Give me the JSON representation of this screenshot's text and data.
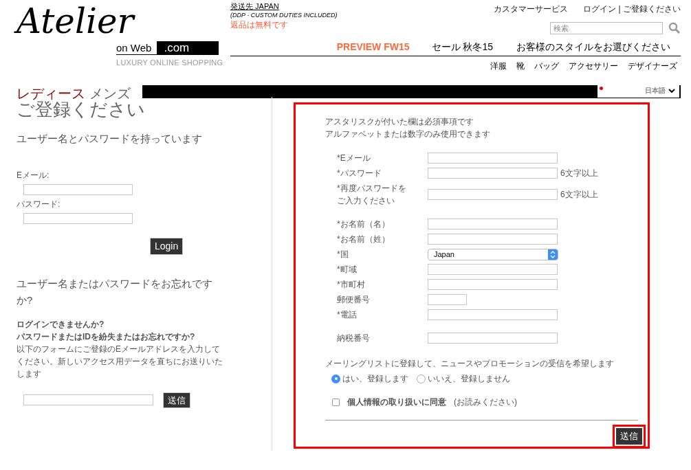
{
  "logo": {
    "script": "Atelier",
    "sub": "on Web",
    "domain": ".com",
    "tagline": "LUXURY ONLINE SHOPPING"
  },
  "shipping": {
    "destination": "発送先 JAPAN",
    "duties": "(DDP - CUSTOM DUTIES INCLUDED)",
    "returns": "返品は無料です"
  },
  "top_links": [
    "カスタマーサービス",
    "ログイン | ご登録ください"
  ],
  "search": {
    "placeholder": "検索"
  },
  "main_nav": [
    {
      "label": "PREVIEW FW15",
      "highlight": true
    },
    {
      "label": "セール 秋冬15",
      "highlight": false
    },
    {
      "label": "お客様のスタイルをお選びください",
      "highlight": false
    }
  ],
  "sub_nav": [
    "洋服",
    "靴",
    "バッグ",
    "アクセサリー",
    "デザイナーズ"
  ],
  "gender_tabs": [
    {
      "label": "レディース",
      "selected": true
    },
    {
      "label": "メンズ",
      "selected": false
    }
  ],
  "language": {
    "label": "日本語"
  },
  "page_title": "ご登録ください",
  "login": {
    "heading": "ユーザー名とパスワードを持っています",
    "fields": [
      {
        "label": "Eメール:"
      },
      {
        "label": "パスワード:"
      }
    ],
    "button": "Login"
  },
  "forgot": {
    "heading": "ユーザー名またはパスワードをお忘れですか?",
    "bold_lines": [
      "ログインできませんか?",
      "パスワードまたはIDを紛失またはお忘れですか?"
    ],
    "text": "以下のフォームにご登録のEメールアドレスを入力してください。新しいアクセス用データを直ちにお送りいたします",
    "button": "送信"
  },
  "register": {
    "notes": [
      "アスタリスクが付いた欄は必須事項です",
      "アルファベットまたは数字のみ使用できます"
    ],
    "fields": [
      {
        "label": "*Eメール",
        "kind": "text"
      },
      {
        "label": "*パスワード",
        "kind": "text",
        "note": "6文字以上"
      },
      {
        "label": "*再度パスワードをご入力ください",
        "kind": "text",
        "note": "6文字以上"
      },
      {
        "label": "*お名前（名）",
        "kind": "text"
      },
      {
        "label": "*お名前（姓）",
        "kind": "text"
      },
      {
        "label": "*国",
        "kind": "select",
        "value": "Japan"
      },
      {
        "label": "*町域",
        "kind": "text"
      },
      {
        "label": "*市町村",
        "kind": "text"
      },
      {
        "label": "郵便番号",
        "kind": "short"
      },
      {
        "label": "*電話",
        "kind": "text"
      },
      {
        "label": "納税番号",
        "kind": "text"
      }
    ],
    "mailing": {
      "question": "メーリングリストに登録して、ニュースやプロモーションの受信を希望します",
      "options": [
        {
          "label": "はい、登録します",
          "selected": true
        },
        {
          "label": "いいえ、登録しません",
          "selected": false
        }
      ]
    },
    "consent": {
      "label": "個人情報の取り扱いに同意",
      "note": "(お読みください)",
      "checked": false
    },
    "button": "送信"
  }
}
